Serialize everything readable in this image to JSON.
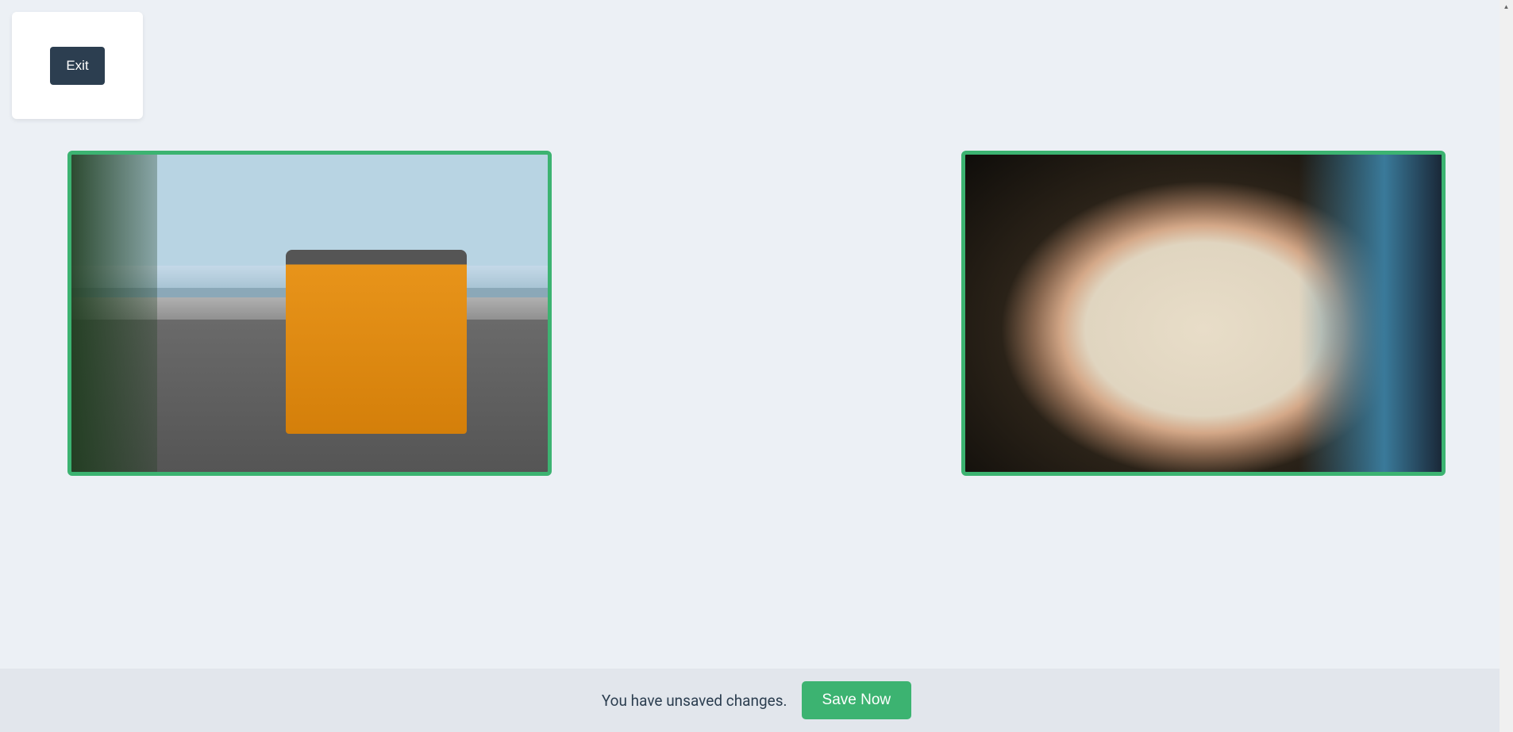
{
  "header": {
    "exit_label": "Exit"
  },
  "images": [
    {
      "name": "image-van-beach",
      "alt": "Orange van at beach parking lot"
    },
    {
      "name": "image-hands-map",
      "alt": "Hands pointing at a paper map"
    }
  ],
  "footer": {
    "unsaved_message": "You have unsaved changes.",
    "save_label": "Save Now"
  },
  "colors": {
    "accent_green": "#3cb371",
    "dark_button": "#2c3e50",
    "page_bg": "#ecf0f5",
    "footer_bg": "#e2e6ec"
  }
}
